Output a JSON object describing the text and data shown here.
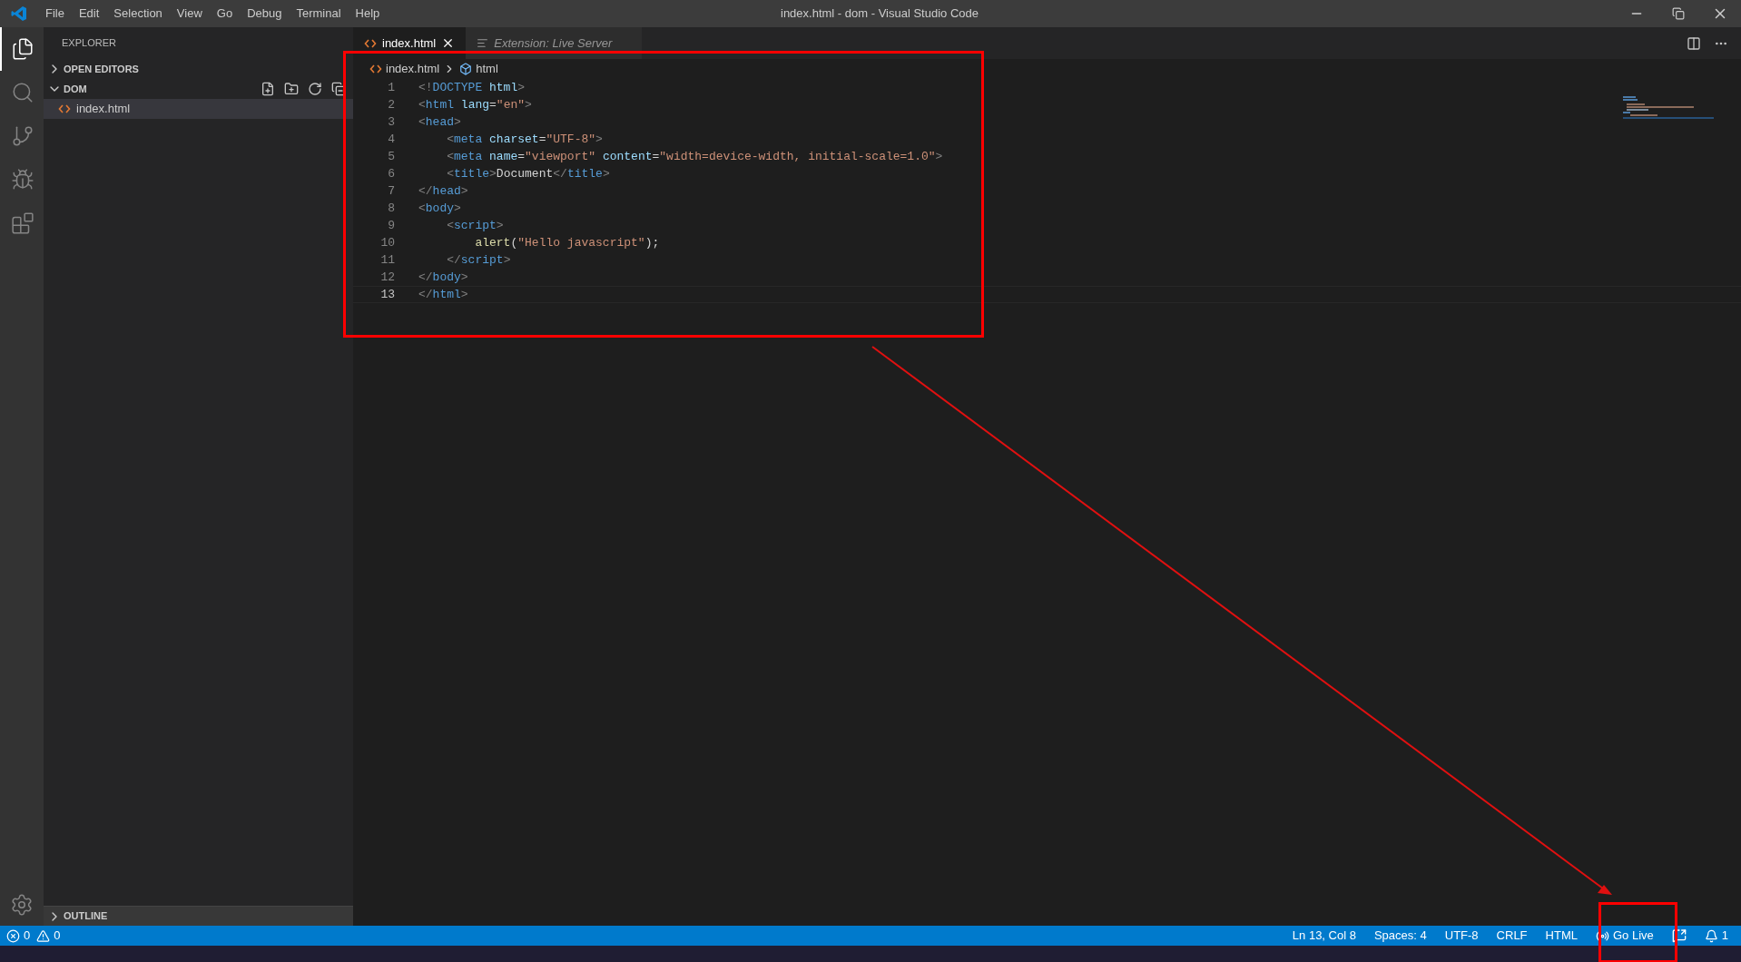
{
  "window": {
    "title": "index.html - dom - Visual Studio Code"
  },
  "menu": [
    "File",
    "Edit",
    "Selection",
    "View",
    "Go",
    "Debug",
    "Terminal",
    "Help"
  ],
  "activity_bar": [
    {
      "kind": "files",
      "selected": true
    },
    {
      "kind": "search",
      "selected": false
    },
    {
      "kind": "source-control",
      "selected": false
    },
    {
      "kind": "debug",
      "selected": false
    },
    {
      "kind": "extensions",
      "selected": false
    }
  ],
  "sidebar": {
    "title": "EXPLORER",
    "sections": [
      {
        "label": "OPEN EDITORS",
        "expanded": false
      },
      {
        "label": "DOM",
        "expanded": true,
        "files": [
          "index.html"
        ]
      }
    ],
    "outline": {
      "label": "OUTLINE",
      "expanded": false
    }
  },
  "tabs": [
    {
      "label": "index.html",
      "selected": true,
      "preview": false
    },
    {
      "label": "Extension: Live Server",
      "selected": false,
      "preview": true
    }
  ],
  "breadcrumbs": [
    "index.html",
    "html"
  ],
  "code": [
    {
      "number": "1",
      "current": false,
      "tokens": [
        {
          "kind": "punct",
          "text": "<!"
        },
        {
          "kind": "tag",
          "text": "DOCTYPE"
        },
        {
          "kind": "attr",
          "text": " html"
        },
        {
          "kind": "punct",
          "text": ">"
        }
      ]
    },
    {
      "number": "2",
      "current": false,
      "tokens": [
        {
          "kind": "punct",
          "text": "<"
        },
        {
          "kind": "tag",
          "text": "html"
        },
        {
          "kind": "attr",
          "text": " lang"
        },
        {
          "kind": "text",
          "text": "="
        },
        {
          "kind": "string",
          "text": "\"en\""
        },
        {
          "kind": "punct",
          "text": ">"
        }
      ]
    },
    {
      "number": "3",
      "current": false,
      "tokens": [
        {
          "kind": "punct",
          "text": "<"
        },
        {
          "kind": "tag",
          "text": "head"
        },
        {
          "kind": "punct",
          "text": ">"
        }
      ]
    },
    {
      "number": "4",
      "current": false,
      "tokens": [
        {
          "kind": "punct",
          "text": "    <"
        },
        {
          "kind": "tag",
          "text": "meta"
        },
        {
          "kind": "attr",
          "text": " charset"
        },
        {
          "kind": "text",
          "text": "="
        },
        {
          "kind": "string",
          "text": "\"UTF-8\""
        },
        {
          "kind": "punct",
          "text": ">"
        }
      ]
    },
    {
      "number": "5",
      "current": false,
      "tokens": [
        {
          "kind": "punct",
          "text": "    <"
        },
        {
          "kind": "tag",
          "text": "meta"
        },
        {
          "kind": "attr",
          "text": " name"
        },
        {
          "kind": "text",
          "text": "="
        },
        {
          "kind": "string",
          "text": "\"viewport\""
        },
        {
          "kind": "attr",
          "text": " content"
        },
        {
          "kind": "text",
          "text": "="
        },
        {
          "kind": "string",
          "text": "\"width=device-width, initial-scale=1.0\""
        },
        {
          "kind": "punct",
          "text": ">"
        }
      ]
    },
    {
      "number": "6",
      "current": false,
      "tokens": [
        {
          "kind": "punct",
          "text": "    <"
        },
        {
          "kind": "tag",
          "text": "title"
        },
        {
          "kind": "punct",
          "text": ">"
        },
        {
          "kind": "text",
          "text": "Document"
        },
        {
          "kind": "punct",
          "text": "</"
        },
        {
          "kind": "tag",
          "text": "title"
        },
        {
          "kind": "punct",
          "text": ">"
        }
      ]
    },
    {
      "number": "7",
      "current": false,
      "tokens": [
        {
          "kind": "punct",
          "text": "</"
        },
        {
          "kind": "tag",
          "text": "head"
        },
        {
          "kind": "punct",
          "text": ">"
        }
      ]
    },
    {
      "number": "8",
      "current": false,
      "tokens": [
        {
          "kind": "punct",
          "text": "<"
        },
        {
          "kind": "tag",
          "text": "body"
        },
        {
          "kind": "punct",
          "text": ">"
        }
      ]
    },
    {
      "number": "9",
      "current": false,
      "tokens": [
        {
          "kind": "punct",
          "text": "    <"
        },
        {
          "kind": "tag",
          "text": "script"
        },
        {
          "kind": "punct",
          "text": ">"
        }
      ]
    },
    {
      "number": "10",
      "current": false,
      "tokens": [
        {
          "kind": "function",
          "text": "        alert"
        },
        {
          "kind": "text",
          "text": "("
        },
        {
          "kind": "string",
          "text": "\"Hello javascript\""
        },
        {
          "kind": "text",
          "text": ");"
        }
      ]
    },
    {
      "number": "11",
      "current": false,
      "tokens": [
        {
          "kind": "punct",
          "text": "    </"
        },
        {
          "kind": "tag",
          "text": "script"
        },
        {
          "kind": "punct",
          "text": ">"
        }
      ]
    },
    {
      "number": "12",
      "current": false,
      "tokens": [
        {
          "kind": "punct",
          "text": "</"
        },
        {
          "kind": "tag",
          "text": "body"
        },
        {
          "kind": "punct",
          "text": ">"
        }
      ]
    },
    {
      "number": "13",
      "current": true,
      "tokens": [
        {
          "kind": "punct",
          "text": "</"
        },
        {
          "kind": "tag",
          "text": "html"
        },
        {
          "kind": "punct",
          "text": ">"
        }
      ]
    }
  ],
  "status_bar": {
    "left": [
      {
        "kind": "errors",
        "text": "0"
      },
      {
        "kind": "warnings",
        "text": "0"
      }
    ],
    "right": [
      {
        "kind": "text",
        "text": "Ln 13, Col 8"
      },
      {
        "kind": "text",
        "text": "Spaces: 4"
      },
      {
        "kind": "text",
        "text": "UTF-8"
      },
      {
        "kind": "text",
        "text": "CRLF"
      },
      {
        "kind": "text",
        "text": "HTML"
      },
      {
        "kind": "golive",
        "text": "Go Live"
      },
      {
        "kind": "feedback"
      },
      {
        "kind": "bell",
        "text": "1"
      }
    ]
  }
}
